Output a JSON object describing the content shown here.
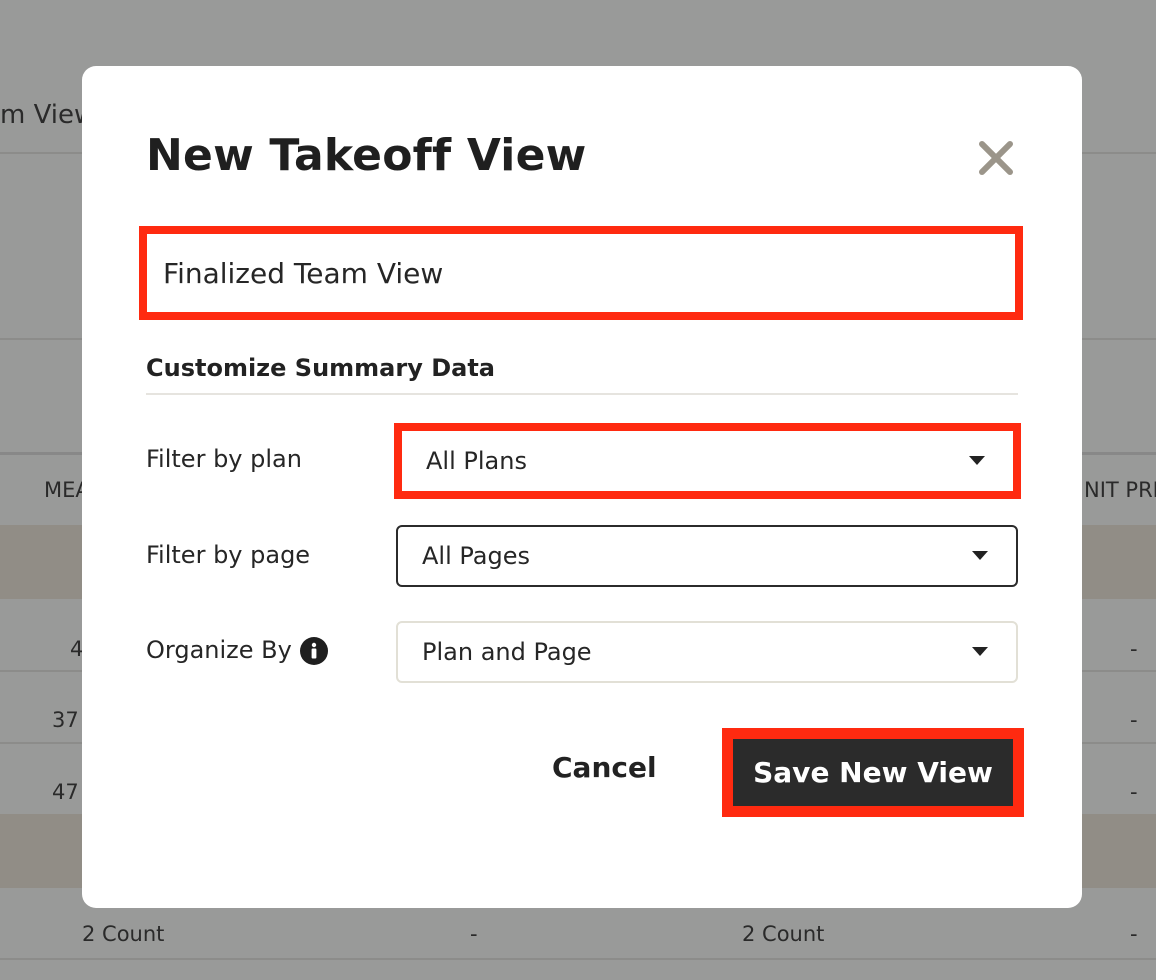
{
  "background": {
    "view_label": "m View",
    "col_mea": "MEA",
    "col_unit_price": "NIT PRIC",
    "rows": [
      {
        "left": "4",
        "right": "-"
      },
      {
        "left": "37",
        "right": "-"
      },
      {
        "left": "47",
        "right": "-"
      }
    ],
    "bottom_row": {
      "c1": "2 Count",
      "c2": "-",
      "c3": "2 Count",
      "c4": "-"
    }
  },
  "modal": {
    "title": "New Takeoff View",
    "close_icon": "close-icon",
    "name_field": {
      "value": "Finalized Team View",
      "placeholder": ""
    },
    "section_title": "Customize Summary Data",
    "filters": {
      "plan": {
        "label": "Filter by plan",
        "value": "All Plans"
      },
      "page": {
        "label": "Filter by page",
        "value": "All Pages"
      },
      "organize": {
        "label": "Organize By",
        "value": "Plan and Page",
        "icon": "info-icon"
      }
    },
    "buttons": {
      "cancel": "Cancel",
      "save": "Save New View"
    }
  },
  "colors": {
    "highlight": "#ff2a10",
    "primary_button": "#2b2b2b",
    "overlay": "#999a99"
  }
}
